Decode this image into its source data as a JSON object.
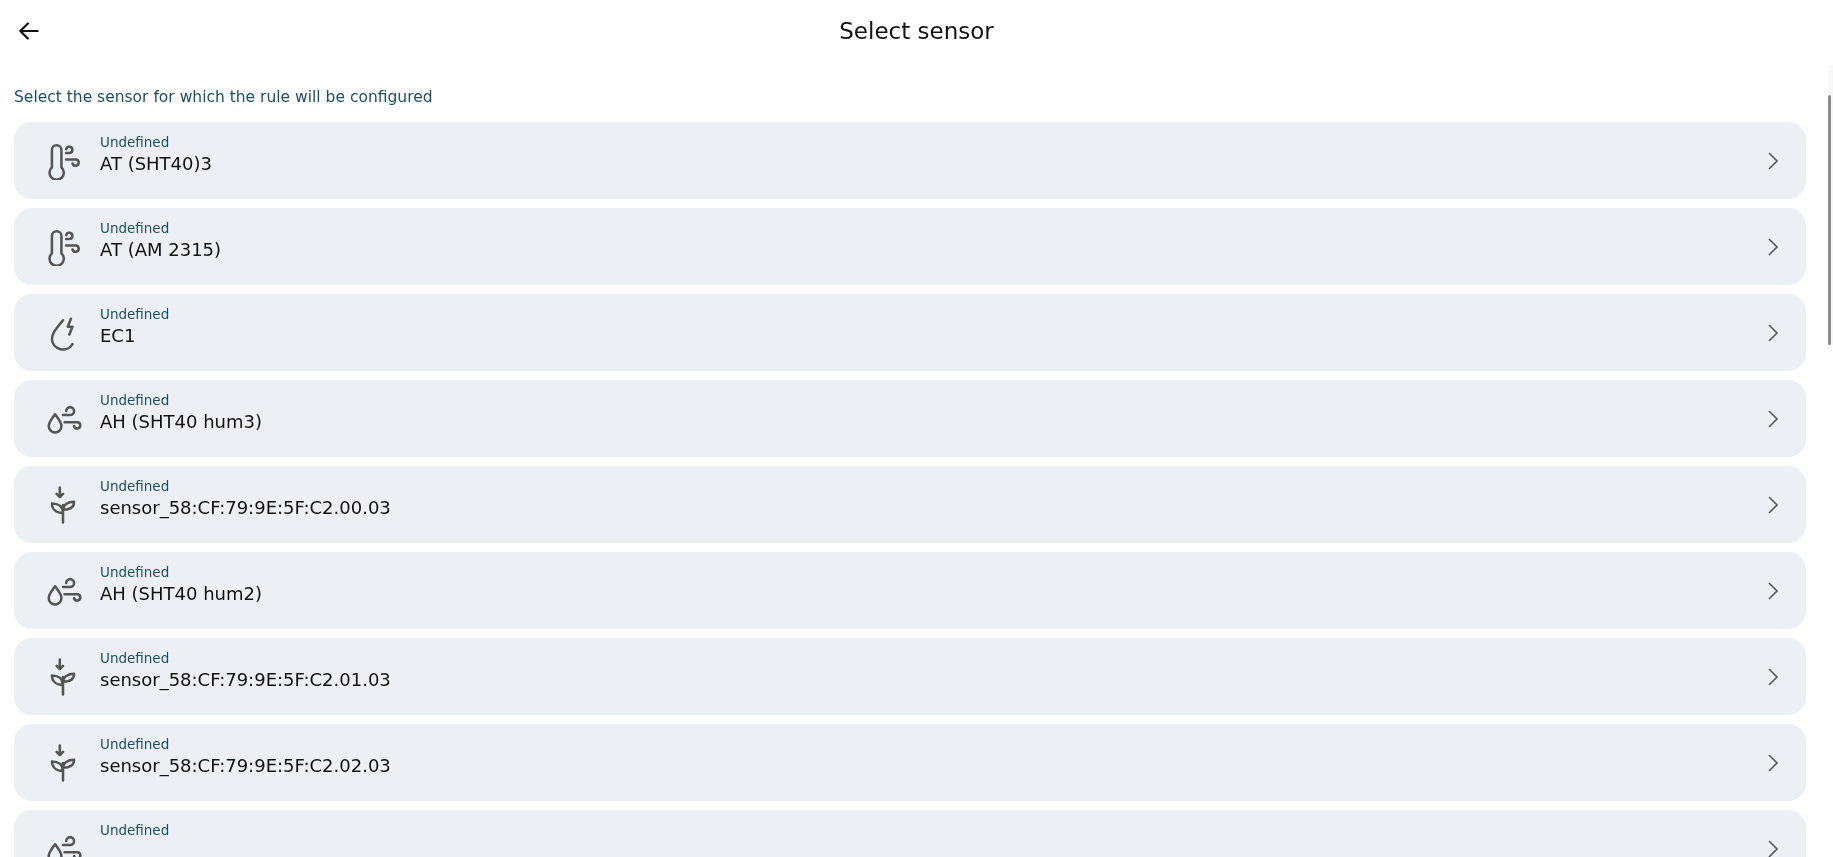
{
  "header": {
    "title": "Select sensor"
  },
  "subtitle": "Select the sensor for which the rule will be configured",
  "sensors": [
    {
      "kind": "air-temperature",
      "status": "Undefined",
      "name": "AT (SHT40)3"
    },
    {
      "kind": "air-temperature",
      "status": "Undefined",
      "name": "AT (AM 2315)"
    },
    {
      "kind": "ec",
      "status": "Undefined",
      "name": "EC1"
    },
    {
      "kind": "air-humidity",
      "status": "Undefined",
      "name": "AH (SHT40 hum3)"
    },
    {
      "kind": "soil",
      "status": "Undefined",
      "name": "sensor_58:CF:79:9E:5F:C2.00.03"
    },
    {
      "kind": "air-humidity",
      "status": "Undefined",
      "name": "AH (SHT40 hum2)"
    },
    {
      "kind": "soil",
      "status": "Undefined",
      "name": "sensor_58:CF:79:9E:5F:C2.01.03"
    },
    {
      "kind": "soil",
      "status": "Undefined",
      "name": "sensor_58:CF:79:9E:5F:C2.02.03"
    },
    {
      "kind": "air-humidity",
      "status": "Undefined"
    }
  ]
}
